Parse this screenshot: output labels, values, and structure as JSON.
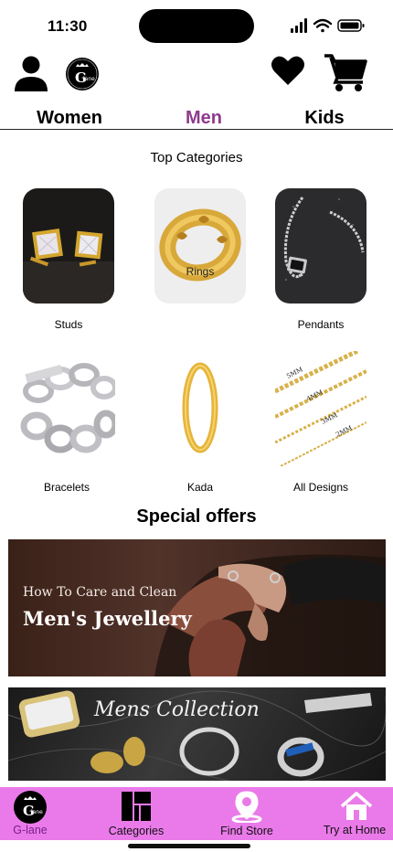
{
  "status_bar": {
    "time": "11:30"
  },
  "header": {
    "logo_text": "G lane",
    "icons": [
      "profile-icon",
      "heart-icon",
      "cart-icon"
    ]
  },
  "gender_tabs": [
    {
      "label": "Women",
      "active": false
    },
    {
      "label": "Men",
      "active": true
    },
    {
      "label": "Kids",
      "active": false
    }
  ],
  "categories_section": {
    "title": "Top Categories",
    "items": [
      {
        "label": "Studs"
      },
      {
        "label": "Rings"
      },
      {
        "label": "Pendants"
      },
      {
        "label": "Bracelets"
      },
      {
        "label": "Kada"
      },
      {
        "label": "All Designs"
      }
    ],
    "chain_sizes": [
      "5MM",
      "4MM",
      "3MM",
      "2MM"
    ]
  },
  "offers_section": {
    "title": "Special offers",
    "banners": [
      {
        "subtitle": "How To Care and Clean",
        "title": "Men's Jewellery"
      },
      {
        "title": "Mens Collection"
      }
    ]
  },
  "bottom_nav": {
    "items": [
      {
        "label": "G-lane",
        "icon": "glane-logo-icon"
      },
      {
        "label": "Categories",
        "icon": "categories-icon"
      },
      {
        "label": "Find Store",
        "icon": "location-pin-icon"
      },
      {
        "label": "Try at Home",
        "icon": "home-icon"
      }
    ]
  },
  "colors": {
    "accent": "#8e3a8e",
    "nav_background": "#ea7ae9"
  }
}
